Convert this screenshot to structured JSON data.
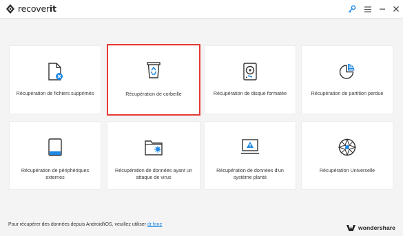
{
  "app": {
    "title_regular": "recover",
    "title_bold": "it"
  },
  "cards": [
    {
      "id": "deleted-files",
      "label": "Récupération de fichiers supprimés",
      "icon": "file-delete-icon"
    },
    {
      "id": "recycle-bin",
      "label": "Récupération de corbeille",
      "icon": "recycle-bin-icon",
      "selected": true
    },
    {
      "id": "formatted-disk",
      "label": "Récupération de disque formatée",
      "icon": "hard-disk-icon"
    },
    {
      "id": "lost-partition",
      "label": "Récupération de partition perdue",
      "icon": "partition-pie-icon"
    },
    {
      "id": "external-devices",
      "label": "Récupération de périphériques externes",
      "icon": "external-drive-icon"
    },
    {
      "id": "virus-attack",
      "label": "Récupération de données ayant un attaque de virus",
      "icon": "virus-folder-icon"
    },
    {
      "id": "system-crash",
      "label": "Récupération de données d'un système planté",
      "icon": "crashed-monitor-icon"
    },
    {
      "id": "universal",
      "label": "Récupération Universelle",
      "icon": "universal-wheel-icon"
    }
  ],
  "footer": {
    "text": "Pour récupérer des données depuis Android/iOS, veuillez utiliser ",
    "link": "dr.fone"
  },
  "brand": {
    "name": "wondershare"
  },
  "colors": {
    "accent": "#1e88e5",
    "selected_border": "#e53935",
    "icon_dark": "#333333"
  }
}
